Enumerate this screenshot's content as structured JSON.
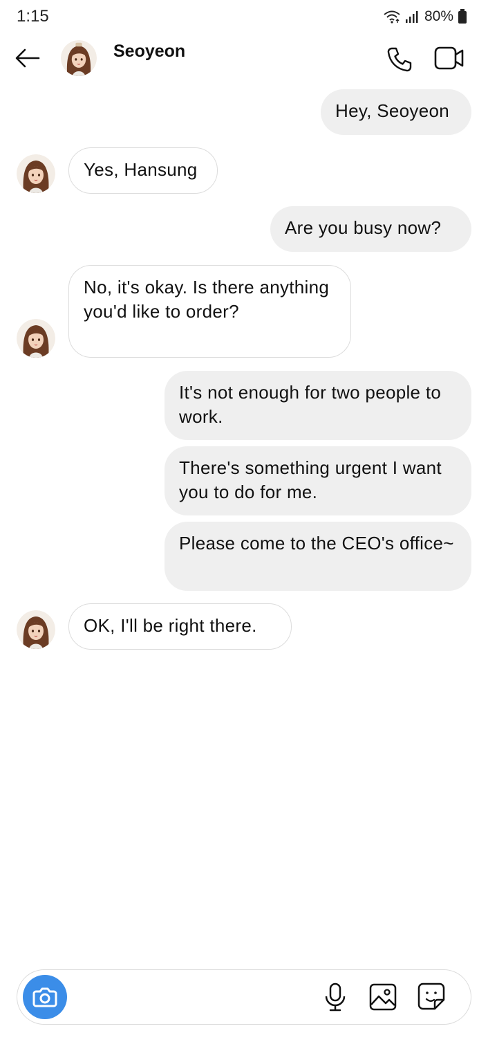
{
  "status_bar": {
    "time": "1:15",
    "battery": "80%",
    "icons": [
      "wifi-icon",
      "signal-icon",
      "battery-icon"
    ]
  },
  "header": {
    "contact_name": "Seoyeon",
    "icons": [
      "back-arrow-icon",
      "phone-icon",
      "video-camera-icon"
    ]
  },
  "messages": [
    {
      "direction": "outgoing",
      "text": "Hey, Seoyeon"
    },
    {
      "direction": "incoming",
      "text": "Yes, Hansung"
    },
    {
      "direction": "outgoing",
      "text": "Are you busy now?"
    },
    {
      "direction": "incoming",
      "text": "No, it's okay. Is there anything you'd like to order?"
    },
    {
      "direction": "outgoing",
      "text": "It's not enough for two people to work."
    },
    {
      "direction": "outgoing",
      "text": "There's something urgent I want you to do for me."
    },
    {
      "direction": "outgoing",
      "text": "Please come to the CEO's office~"
    },
    {
      "direction": "incoming",
      "text": "OK, I'll be right there."
    }
  ],
  "composer": {
    "icons": [
      "camera-icon",
      "microphone-icon",
      "image-icon",
      "sticker-icon"
    ]
  },
  "colors": {
    "outgoing_bubble": "#efefef",
    "incoming_border": "#dcdcdc",
    "camera_button": "#3b8de8"
  }
}
